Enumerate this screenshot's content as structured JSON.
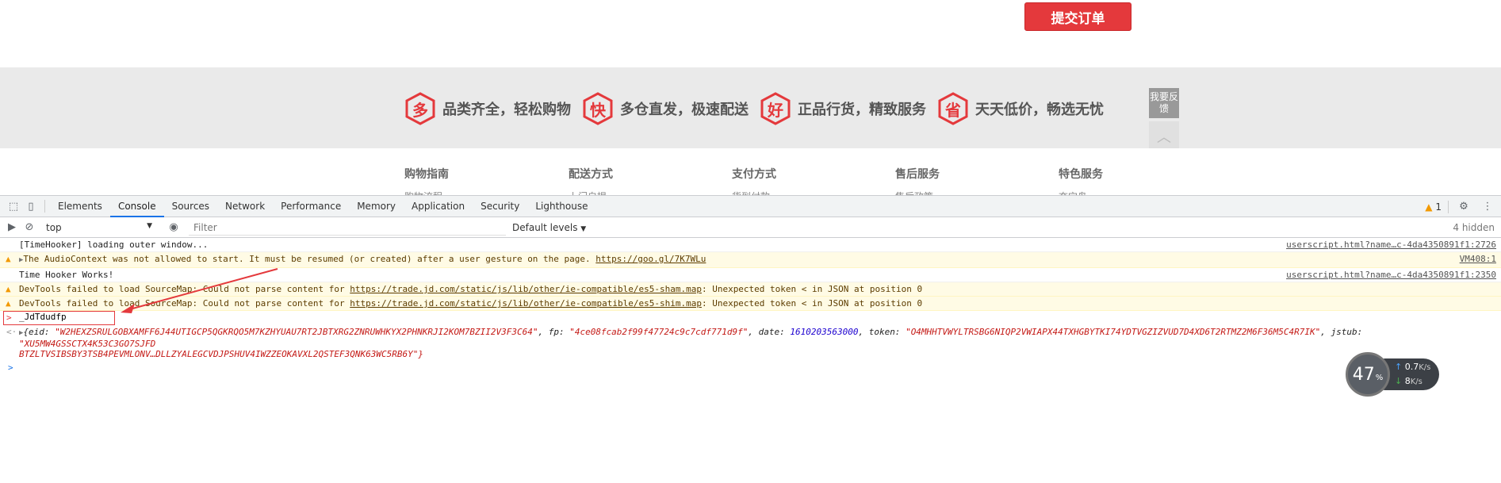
{
  "page": {
    "submit_label": "提交订单",
    "promises": [
      {
        "glyph": "多",
        "text": "品类齐全，轻松购物"
      },
      {
        "glyph": "快",
        "text": "多仓直发，极速配送"
      },
      {
        "glyph": "好",
        "text": "正品行货，精致服务"
      },
      {
        "glyph": "省",
        "text": "天天低价，畅选无忧"
      }
    ],
    "feedback_label": "我要反馈",
    "footer": [
      {
        "heading": "购物指南",
        "sub": "购物流程"
      },
      {
        "heading": "配送方式",
        "sub": "上门自提"
      },
      {
        "heading": "支付方式",
        "sub": "货到付款"
      },
      {
        "heading": "售后服务",
        "sub": "售后政策"
      },
      {
        "heading": "特色服务",
        "sub": "夺宝岛"
      }
    ],
    "accent_color": "#e4393c"
  },
  "devtools": {
    "tabs": [
      "Elements",
      "Console",
      "Sources",
      "Network",
      "Performance",
      "Memory",
      "Application",
      "Security",
      "Lighthouse"
    ],
    "active_tab": "Console",
    "warning_count": "1",
    "context": "top",
    "filter_placeholder": "Filter",
    "levels": "Default levels",
    "hidden": "4 hidden",
    "messages": [
      {
        "type": "log",
        "text": "[TimeHooker] loading outer window...",
        "source": "userscript.html?name…c-4da4350891f1:2726"
      },
      {
        "type": "warn",
        "text_before": "The AudioContext was not allowed to start. It must be resumed (or created) after a user gesture on the page.",
        "link": "https://goo.gl/7K7WLu",
        "source": "VM408:1"
      },
      {
        "type": "log",
        "text": "Time Hooker Works!",
        "source": "userscript.html?name…c-4da4350891f1:2350"
      },
      {
        "type": "warn",
        "text_before": "DevTools failed to load SourceMap: Could not parse content for",
        "link": "https://trade.jd.com/static/js/lib/other/ie-compatible/es5-sham.map",
        "text_after": ": Unexpected token < in JSON at position 0"
      },
      {
        "type": "warn",
        "text_before": "DevTools failed to load SourceMap: Could not parse content for",
        "link": "https://trade.jd.com/static/js/lib/other/ie-compatible/es5-shim.map",
        "text_after": ": Unexpected token < in JSON at position 0"
      }
    ],
    "input_command": "_JdTdudfp",
    "result": {
      "eid": "W2HEXZSRULGOBXAMFF6J44UTIGCP5QGKRQO5M7KZHYUAU7RT2JBTXRG2ZNRUWHKYX2PHNKRJI2KOM7BZII2V3F3C64",
      "fp": "4ce08fcab2f99f47724c9c7cdf771d9f",
      "date": "1610203563000",
      "token": "O4MHHTVWYLTRSBG6NIQP2VWIAPX44TXHGBYTKI74YDTVGZIZVUD7D4XD6T2RTMZ2M6F36M5C4R7IK",
      "jstub": "XU5MW4GSSCTX4K53C3GO7SJFD",
      "line2": "BTZLTVSIBSBY3TSB4PEVMLONV…DLLZYALEGCVDJPSHUV4IWZZEOKAVXL2QSTEF3QNK63WC5RB6Y\"}"
    }
  },
  "speed": {
    "percent": "47",
    "pct_sign": "%",
    "up": "0.7",
    "up_unit": "K/s",
    "down": "8",
    "down_unit": "K/s"
  }
}
